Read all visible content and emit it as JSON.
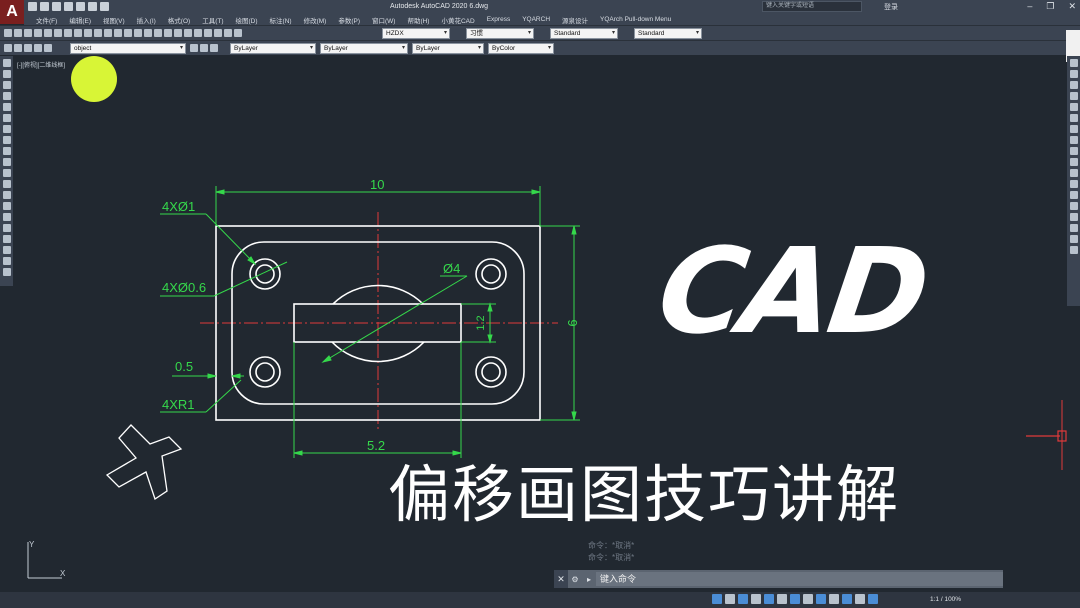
{
  "app": {
    "title": "Autodesk AutoCAD 2020    6.dwg",
    "logo_letter": "A",
    "search_placeholder": "键入关键字或短语",
    "login": "登录"
  },
  "menu": [
    "文件(F)",
    "编辑(E)",
    "视图(V)",
    "插入(I)",
    "格式(O)",
    "工具(T)",
    "绘图(D)",
    "标注(N)",
    "修改(M)",
    "参数(P)",
    "窗口(W)",
    "帮助(H)",
    "小黄花CAD",
    "Express",
    "YQARCH",
    "源泉设计",
    "YQArch Pull-down Menu"
  ],
  "toolbar": {
    "dimstyle": "HZDX",
    "textstyle": "习惯",
    "tablestyle": "Standard",
    "mleaderstyle": "Standard",
    "layer": "object",
    "color": "ByLayer",
    "linetype": "ByLayer",
    "lineweight": "ByLayer",
    "plotstyle": "ByColor"
  },
  "viewport_label": "[-][俯视][二维线框]",
  "dimensions": {
    "top_width": "10",
    "height": "6",
    "hole_large": "4XØ1",
    "hole_small": "4XØ0.6",
    "circle_dia": "Ø4",
    "slot_height": "1.2",
    "offset": "0.5",
    "corner_radius": "4XR1",
    "slot_width": "5.2"
  },
  "overlay": {
    "logo_text": "CAD",
    "subtitle": "偏移画图技巧讲解"
  },
  "command": {
    "history": [
      "命令：*取消*",
      "命令：*取消*"
    ],
    "placeholder": "键入命令"
  },
  "ucs": {
    "x": "X",
    "y": "Y"
  },
  "status": {
    "scale": "1:1 / 100%"
  },
  "colors": {
    "dimension": "#35d84b",
    "centerline": "#e03a3a",
    "geometry": "#ffffff",
    "highlight": "#d8f536"
  }
}
